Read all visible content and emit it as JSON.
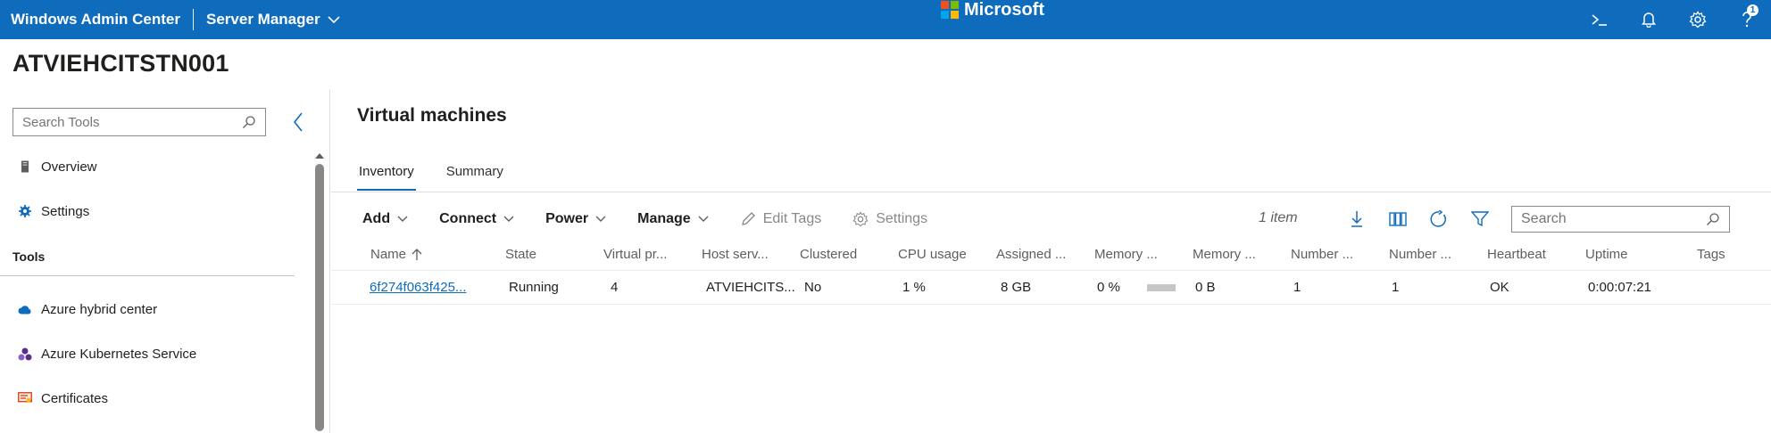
{
  "topbar": {
    "brand": "Windows Admin Center",
    "context": "Server Manager",
    "ms_text": "Microsoft",
    "help_badge": "1",
    "icons": [
      "terminal-icon",
      "bell-icon",
      "gear-icon",
      "help-icon"
    ]
  },
  "server": {
    "name": "ATVIEHCITSTN001"
  },
  "sidebar": {
    "search_placeholder": "Search Tools",
    "items_top": [
      {
        "label": "Overview",
        "icon": "server-icon"
      },
      {
        "label": "Settings",
        "icon": "gear-icon"
      }
    ],
    "tools_header": "Tools",
    "tools": [
      {
        "label": "Azure hybrid center",
        "icon": "cloud-icon"
      },
      {
        "label": "Azure Kubernetes Service",
        "icon": "kubernetes-icon"
      },
      {
        "label": "Certificates",
        "icon": "certificate-icon"
      }
    ]
  },
  "main": {
    "title": "Virtual machines",
    "tabs": [
      {
        "label": "Inventory",
        "active": true
      },
      {
        "label": "Summary",
        "active": false
      }
    ],
    "toolbar": {
      "add": "Add",
      "connect": "Connect",
      "power": "Power",
      "manage": "Manage",
      "edit_tags": "Edit Tags",
      "settings": "Settings",
      "item_count": "1 item",
      "search_placeholder": "Search"
    },
    "table": {
      "headers": [
        "Name",
        "State",
        "Virtual pr...",
        "Host serv...",
        "Clustered",
        "CPU usage",
        "Assigned ...",
        "Memory ...",
        "Memory ...",
        "Number ...",
        "Number ...",
        "Heartbeat",
        "Uptime",
        "Tags"
      ],
      "rows": [
        {
          "name": "6f274f063f425...",
          "state": "Running",
          "virtual_processors": "4",
          "host_server": "ATVIEHCITS...",
          "clustered": "No",
          "cpu_usage": "1 %",
          "assigned_memory": "8 GB",
          "memory_pressure": "0 %",
          "memory_demand": "0 B",
          "number_a": "1",
          "number_b": "1",
          "heartbeat": "OK",
          "uptime": "0:00:07:21",
          "tags": ""
        }
      ]
    }
  },
  "colors": {
    "accent": "#0f6cbd",
    "topbar": "#0f6cbd"
  }
}
